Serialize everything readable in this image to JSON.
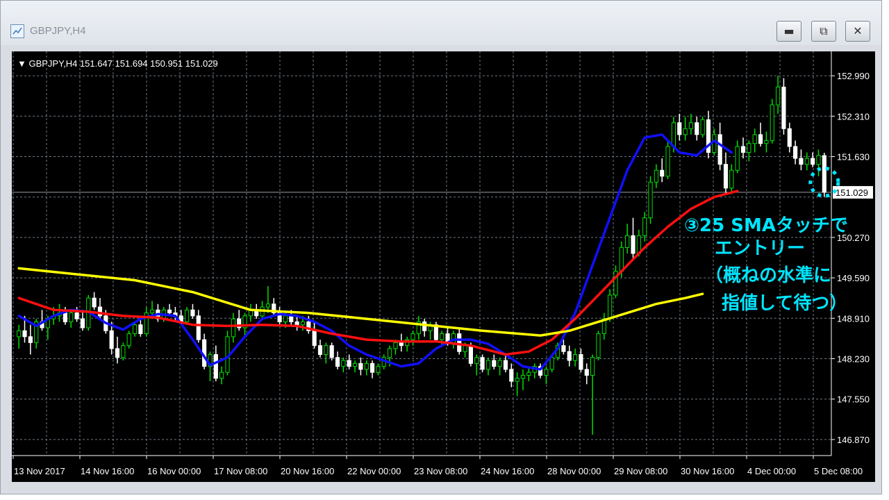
{
  "window": {
    "title": "GBPJPY,H4",
    "icon": "chart-window-icon",
    "minimize_icon": "minimize-icon",
    "maximize_icon": "restore-icon",
    "close_icon": "close-icon"
  },
  "chart_data": {
    "type": "candlestick",
    "header": "GBPJPY,H4  151.647 151.694 150.951 151.029",
    "current_price": 151.029,
    "current_price_label": "151.029",
    "ylim": [
      146.6,
      153.4
    ],
    "y_ticks": [
      "152.990",
      "152.310",
      "151.630",
      "150.270",
      "149.590",
      "148.910",
      "148.230",
      "147.550",
      "146.870"
    ],
    "x_ticks": [
      "13 Nov 2017",
      "14 Nov 16:00",
      "16 Nov 00:00",
      "17 Nov 08:00",
      "20 Nov 16:00",
      "22 Nov 00:00",
      "23 Nov 08:00",
      "24 Nov 16:00",
      "28 Nov 00:00",
      "29 Nov 08:00",
      "30 Nov 16:00",
      "4 Dec 00:00",
      "5 Dec 08:00"
    ],
    "grid": true,
    "colors": {
      "background": "#000000",
      "grid": "#6f7a86",
      "bull_candle": "#00e000",
      "bear_candle": "#ffffff",
      "text": "#ffffff",
      "annotation": "#00e5ff"
    },
    "series": [
      {
        "type": "line",
        "color": "#1010ff",
        "x": [
          0,
          3,
          6,
          9,
          12,
          15,
          18,
          21,
          24,
          27,
          30,
          33,
          36,
          39,
          42,
          45,
          48,
          51,
          54,
          57,
          60,
          63,
          66,
          69,
          72,
          75,
          78,
          81,
          84,
          87,
          90,
          93,
          96,
          99,
          102,
          105,
          108,
          111,
          114,
          117,
          120,
          123
        ],
        "values": [
          148.95,
          148.78,
          148.95,
          149.05,
          149.02,
          148.83,
          148.72,
          148.9,
          148.98,
          148.95,
          148.55,
          148.12,
          148.25,
          148.6,
          148.9,
          148.98,
          148.95,
          148.85,
          148.7,
          148.45,
          148.3,
          148.2,
          148.1,
          148.15,
          148.4,
          148.55,
          148.55,
          148.48,
          148.3,
          148.1,
          148.05,
          148.4,
          149.0,
          149.8,
          150.6,
          151.4,
          151.95,
          152.0,
          151.7,
          151.65,
          151.9,
          151.7
        ]
      },
      {
        "type": "line",
        "color": "#ff1010",
        "x": [
          0,
          6,
          12,
          18,
          24,
          30,
          36,
          42,
          48,
          54,
          60,
          66,
          72,
          78,
          84,
          88,
          92,
          96,
          100,
          104,
          108,
          112,
          116,
          120,
          124
        ],
        "values": [
          149.25,
          149.05,
          149.02,
          148.95,
          148.92,
          148.8,
          148.78,
          148.8,
          148.78,
          148.65,
          148.55,
          148.52,
          148.52,
          148.45,
          148.3,
          148.35,
          148.55,
          148.9,
          149.3,
          149.7,
          150.1,
          150.45,
          150.75,
          150.95,
          151.05
        ]
      },
      {
        "type": "line",
        "color": "#ffff00",
        "x": [
          0,
          10,
          20,
          30,
          40,
          50,
          60,
          70,
          80,
          90,
          95,
          100,
          105,
          110,
          115,
          118
        ],
        "values": [
          149.75,
          149.65,
          149.55,
          149.35,
          149.05,
          149.0,
          148.9,
          148.8,
          148.7,
          148.62,
          148.7,
          148.85,
          149.0,
          149.15,
          149.25,
          149.32
        ]
      }
    ],
    "candles": [
      [
        148.6,
        148.8,
        148.4,
        148.7
      ],
      [
        148.7,
        148.95,
        148.5,
        148.6
      ],
      [
        148.6,
        148.8,
        148.3,
        148.5
      ],
      [
        148.5,
        148.9,
        148.4,
        148.85
      ],
      [
        148.85,
        149.05,
        148.7,
        148.75
      ],
      [
        148.75,
        148.95,
        148.55,
        148.9
      ],
      [
        148.9,
        149.1,
        148.8,
        148.95
      ],
      [
        148.95,
        149.15,
        148.85,
        149.0
      ],
      [
        149.0,
        149.1,
        148.8,
        148.85
      ],
      [
        148.85,
        149.05,
        148.75,
        149.0
      ],
      [
        149.0,
        149.1,
        148.85,
        148.9
      ],
      [
        148.9,
        149.05,
        148.7,
        148.75
      ],
      [
        148.75,
        149.3,
        148.7,
        149.25
      ],
      [
        149.25,
        149.35,
        149.05,
        149.1
      ],
      [
        149.1,
        149.25,
        148.9,
        148.95
      ],
      [
        148.95,
        149.05,
        148.65,
        148.7
      ],
      [
        148.7,
        148.85,
        148.3,
        148.4
      ],
      [
        148.4,
        148.6,
        148.15,
        148.25
      ],
      [
        148.25,
        148.5,
        148.2,
        148.45
      ],
      [
        148.45,
        148.7,
        148.4,
        148.65
      ],
      [
        148.65,
        148.85,
        148.6,
        148.8
      ],
      [
        148.8,
        148.95,
        148.6,
        148.65
      ],
      [
        148.65,
        149.1,
        148.6,
        149.0
      ],
      [
        149.0,
        149.2,
        148.9,
        149.05
      ],
      [
        149.05,
        149.15,
        148.85,
        148.9
      ],
      [
        148.9,
        149.1,
        148.85,
        149.05
      ],
      [
        149.05,
        149.15,
        148.95,
        149.0
      ],
      [
        149.0,
        149.1,
        148.85,
        148.95
      ],
      [
        148.95,
        149.05,
        148.8,
        148.85
      ],
      [
        148.85,
        149.1,
        148.8,
        149.05
      ],
      [
        149.05,
        149.15,
        148.9,
        148.95
      ],
      [
        148.95,
        149.05,
        148.5,
        148.55
      ],
      [
        148.55,
        148.65,
        148.05,
        148.1
      ],
      [
        148.1,
        148.35,
        147.85,
        148.3
      ],
      [
        148.3,
        148.45,
        147.85,
        147.9
      ],
      [
        147.9,
        148.1,
        147.8,
        148.0
      ],
      [
        148.0,
        148.7,
        147.95,
        148.6
      ],
      [
        148.6,
        149.0,
        148.5,
        148.9
      ],
      [
        148.9,
        149.05,
        148.7,
        148.75
      ],
      [
        148.75,
        149.0,
        148.6,
        148.95
      ],
      [
        148.95,
        149.15,
        148.85,
        149.05
      ],
      [
        149.05,
        149.15,
        148.9,
        148.95
      ],
      [
        148.95,
        149.2,
        148.9,
        149.1
      ],
      [
        149.1,
        149.45,
        149.0,
        149.15
      ],
      [
        149.15,
        149.25,
        148.95,
        149.0
      ],
      [
        149.0,
        149.1,
        148.8,
        148.85
      ],
      [
        148.85,
        149.0,
        148.75,
        148.95
      ],
      [
        148.95,
        149.05,
        148.8,
        148.85
      ],
      [
        148.85,
        148.95,
        148.7,
        148.8
      ],
      [
        148.8,
        148.95,
        148.7,
        148.85
      ],
      [
        148.85,
        148.95,
        148.65,
        148.7
      ],
      [
        148.7,
        148.85,
        148.4,
        148.45
      ],
      [
        148.45,
        148.55,
        148.25,
        148.3
      ],
      [
        148.3,
        148.5,
        148.15,
        148.45
      ],
      [
        148.45,
        148.5,
        148.2,
        148.25
      ],
      [
        148.25,
        148.35,
        148.05,
        148.1
      ],
      [
        148.1,
        148.25,
        148.0,
        148.2
      ],
      [
        148.2,
        148.3,
        148.05,
        148.1
      ],
      [
        148.1,
        148.2,
        148.0,
        148.15
      ],
      [
        148.15,
        148.25,
        147.95,
        148.05
      ],
      [
        148.05,
        148.2,
        147.95,
        148.15
      ],
      [
        148.15,
        148.2,
        147.9,
        148.0
      ],
      [
        148.0,
        148.15,
        147.95,
        148.1
      ],
      [
        148.1,
        148.3,
        148.05,
        148.25
      ],
      [
        148.25,
        148.45,
        148.1,
        148.4
      ],
      [
        148.4,
        148.55,
        148.3,
        148.5
      ],
      [
        148.5,
        148.65,
        148.35,
        148.45
      ],
      [
        148.45,
        148.6,
        148.35,
        148.55
      ],
      [
        148.55,
        148.7,
        148.45,
        148.65
      ],
      [
        148.65,
        148.95,
        148.55,
        148.85
      ],
      [
        148.85,
        148.9,
        148.6,
        148.7
      ],
      [
        148.7,
        148.85,
        148.55,
        148.8
      ],
      [
        148.8,
        148.85,
        148.5,
        148.55
      ],
      [
        148.55,
        148.7,
        148.45,
        148.65
      ],
      [
        148.65,
        148.75,
        148.45,
        148.5
      ],
      [
        148.5,
        148.7,
        148.4,
        148.65
      ],
      [
        148.65,
        148.75,
        148.3,
        148.35
      ],
      [
        148.35,
        148.5,
        148.25,
        148.45
      ],
      [
        148.45,
        148.5,
        148.1,
        148.15
      ],
      [
        148.15,
        148.3,
        147.95,
        148.25
      ],
      [
        148.25,
        148.3,
        148.0,
        148.05
      ],
      [
        148.05,
        148.25,
        147.95,
        148.2
      ],
      [
        148.2,
        148.3,
        148.05,
        148.1
      ],
      [
        148.1,
        148.25,
        147.95,
        148.2
      ],
      [
        148.2,
        148.3,
        148.0,
        148.05
      ],
      [
        148.05,
        148.15,
        147.75,
        147.85
      ],
      [
        147.85,
        148.0,
        147.6,
        147.9
      ],
      [
        147.9,
        148.05,
        147.7,
        147.95
      ],
      [
        147.95,
        148.1,
        147.85,
        148.0
      ],
      [
        148.0,
        148.15,
        147.9,
        148.1
      ],
      [
        148.1,
        148.15,
        147.9,
        147.95
      ],
      [
        147.95,
        148.1,
        147.8,
        148.05
      ],
      [
        148.05,
        148.3,
        148.0,
        148.25
      ],
      [
        148.25,
        148.5,
        148.2,
        148.45
      ],
      [
        148.45,
        148.55,
        148.3,
        148.35
      ],
      [
        148.35,
        148.45,
        148.1,
        148.2
      ],
      [
        148.2,
        148.4,
        148.1,
        148.3
      ],
      [
        148.3,
        148.4,
        148.0,
        148.05
      ],
      [
        148.05,
        148.15,
        147.8,
        147.95
      ],
      [
        147.95,
        148.3,
        146.95,
        148.25
      ],
      [
        148.25,
        148.7,
        148.2,
        148.65
      ],
      [
        148.65,
        149.0,
        148.55,
        148.9
      ],
      [
        148.9,
        149.4,
        148.85,
        149.3
      ],
      [
        149.3,
        149.8,
        149.25,
        149.7
      ],
      [
        149.7,
        150.2,
        149.6,
        150.1
      ],
      [
        150.1,
        150.5,
        150.0,
        150.3
      ],
      [
        150.3,
        150.6,
        149.9,
        150.0
      ],
      [
        150.0,
        150.4,
        149.95,
        150.3
      ],
      [
        150.3,
        150.7,
        150.2,
        150.6
      ],
      [
        150.6,
        151.3,
        150.5,
        151.2
      ],
      [
        151.2,
        151.5,
        151.1,
        151.4
      ],
      [
        151.4,
        151.6,
        151.2,
        151.3
      ],
      [
        151.3,
        151.9,
        151.25,
        151.8
      ],
      [
        151.8,
        152.3,
        151.7,
        152.2
      ],
      [
        152.2,
        152.35,
        151.9,
        152.0
      ],
      [
        152.0,
        152.3,
        151.9,
        152.1
      ],
      [
        152.1,
        152.35,
        152.0,
        152.2
      ],
      [
        152.2,
        152.3,
        151.9,
        152.0
      ],
      [
        152.0,
        152.3,
        151.95,
        152.25
      ],
      [
        152.25,
        152.4,
        151.6,
        151.7
      ],
      [
        151.7,
        152.1,
        151.65,
        152.0
      ],
      [
        152.0,
        152.2,
        151.4,
        151.5
      ],
      [
        151.5,
        151.7,
        151.0,
        151.1
      ],
      [
        151.1,
        151.5,
        151.0,
        151.4
      ],
      [
        151.4,
        151.9,
        151.35,
        151.8
      ],
      [
        151.8,
        151.95,
        151.6,
        151.7
      ],
      [
        151.7,
        151.9,
        151.55,
        151.85
      ],
      [
        151.85,
        152.1,
        151.7,
        152.0
      ],
      [
        152.0,
        152.2,
        151.8,
        151.85
      ],
      [
        151.85,
        152.05,
        151.7,
        151.9
      ],
      [
        151.9,
        152.6,
        151.85,
        152.5
      ],
      [
        152.5,
        152.99,
        152.35,
        152.8
      ],
      [
        152.8,
        152.95,
        152.0,
        152.1
      ],
      [
        152.1,
        152.2,
        151.7,
        151.8
      ],
      [
        151.8,
        151.9,
        151.5,
        151.6
      ],
      [
        151.6,
        151.75,
        151.4,
        151.5
      ],
      [
        151.5,
        151.7,
        151.4,
        151.6
      ],
      [
        151.6,
        151.7,
        151.45,
        151.5
      ],
      [
        151.5,
        151.75,
        151.3,
        151.65
      ],
      [
        151.647,
        151.694,
        150.951,
        151.029
      ]
    ],
    "annotation_lines": [
      "③25 SMAタッチで",
      "エントリー",
      "（概ねの水準に",
      "指値して待つ）"
    ]
  }
}
